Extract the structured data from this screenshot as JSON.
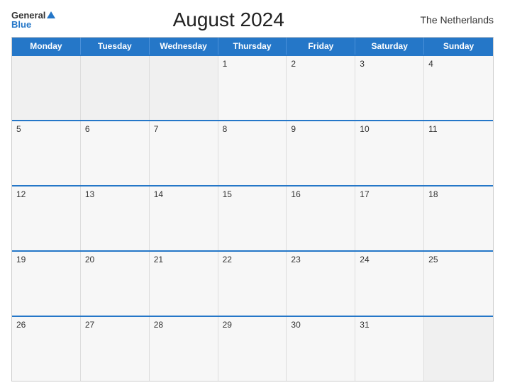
{
  "logo": {
    "general": "General",
    "blue": "Blue"
  },
  "title": "August 2024",
  "country": "The Netherlands",
  "days_header": [
    "Monday",
    "Tuesday",
    "Wednesday",
    "Thursday",
    "Friday",
    "Saturday",
    "Sunday"
  ],
  "weeks": [
    [
      null,
      null,
      null,
      1,
      2,
      3,
      4
    ],
    [
      5,
      6,
      7,
      8,
      9,
      10,
      11
    ],
    [
      12,
      13,
      14,
      15,
      16,
      17,
      18
    ],
    [
      19,
      20,
      21,
      22,
      23,
      24,
      25
    ],
    [
      26,
      27,
      28,
      29,
      30,
      31,
      null
    ]
  ]
}
